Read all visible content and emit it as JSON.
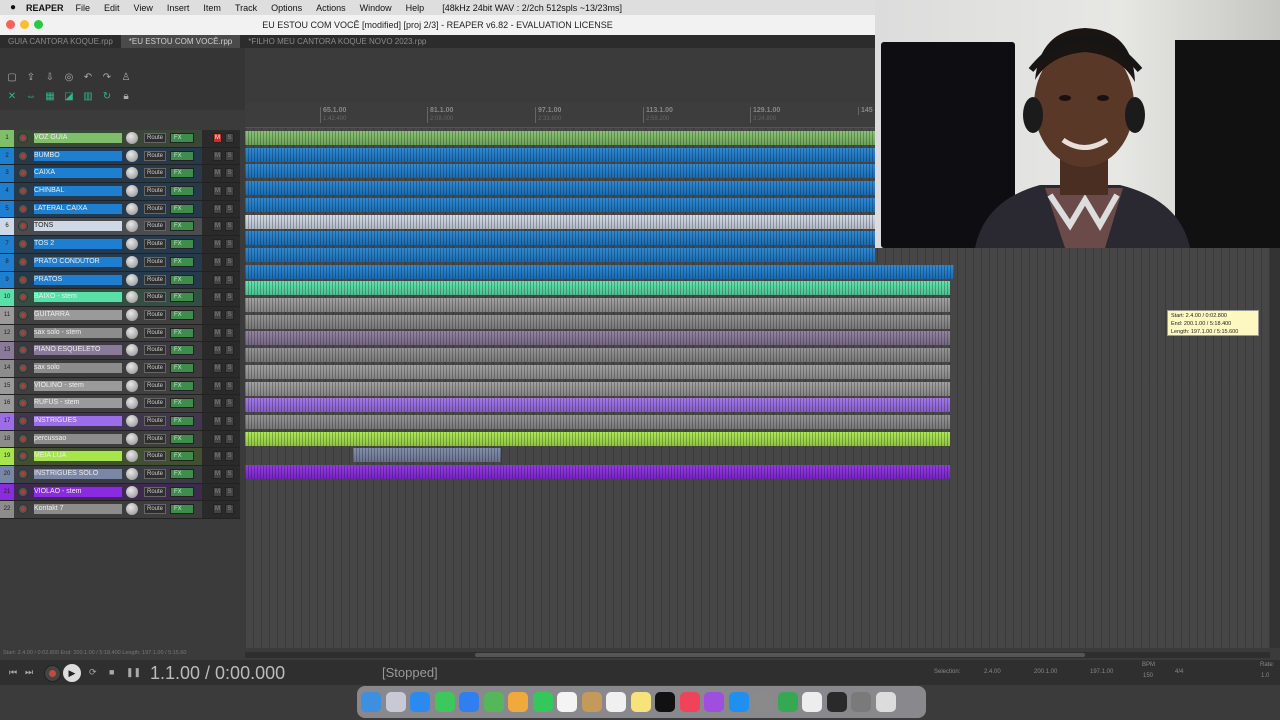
{
  "menubar": {
    "app": "REAPER",
    "items": [
      "File",
      "Edit",
      "View",
      "Insert",
      "Item",
      "Track",
      "Options",
      "Actions",
      "Window",
      "Help"
    ],
    "info": "[48kHz 24bit WAV : 2/2ch 512spls ~13/23ms]"
  },
  "window": {
    "title": "EU ESTOU COM VOCÊ [modified] [proj 2/3] - REAPER v6.82 - EVALUATION LICENSE"
  },
  "project_tabs": [
    {
      "label": "GUIA CANTORA KOQUE.rpp",
      "active": false
    },
    {
      "label": "*EU ESTOU COM VOCÊ.rpp",
      "active": true
    },
    {
      "label": "*FILHO MEU CANTORA KOQUE NOVO 2023.rpp",
      "active": false
    }
  ],
  "ruler": {
    "marks": [
      {
        "bar": "65.1.00",
        "time": "1:42.400"
      },
      {
        "bar": "81.1.00",
        "time": "2:08.000"
      },
      {
        "bar": "97.1.00",
        "time": "2:33.600"
      },
      {
        "bar": "113.1.00",
        "time": "2:59.200"
      },
      {
        "bar": "129.1.00",
        "time": "3:24.800"
      },
      {
        "bar": "145",
        "time": ""
      }
    ]
  },
  "track_labels": {
    "route": "Route",
    "fx": "FX",
    "mute": "M",
    "solo": "S"
  },
  "tracks": [
    {
      "num": "1",
      "name": "VOZ GUIA",
      "color": "#7fbf6a",
      "muted": true
    },
    {
      "num": "2",
      "name": "BUMBO",
      "color": "#1e7fd0",
      "muted": false
    },
    {
      "num": "3",
      "name": "CAIXA",
      "color": "#1e7fd0",
      "muted": false
    },
    {
      "num": "4",
      "name": "CHINBAL",
      "color": "#1e7fd0",
      "muted": false
    },
    {
      "num": "5",
      "name": "LATERAL CAIXA",
      "color": "#1e7fd0",
      "muted": false
    },
    {
      "num": "6",
      "name": "TONS",
      "color": "#cfd8e6",
      "muted": false
    },
    {
      "num": "7",
      "name": "TOS 2",
      "color": "#1e7fd0",
      "muted": false
    },
    {
      "num": "8",
      "name": "PRATO CONDUTOR",
      "color": "#1e7fd0",
      "muted": false
    },
    {
      "num": "9",
      "name": "PRATOS",
      "color": "#1e7fd0",
      "muted": false
    },
    {
      "num": "10",
      "name": "BAIXO - stem",
      "color": "#58e0a8",
      "muted": false
    },
    {
      "num": "11",
      "name": "GUITARRA",
      "color": "#9a9a9a",
      "muted": false
    },
    {
      "num": "12",
      "name": "sax solo - stem",
      "color": "#8c8c8c",
      "muted": false
    },
    {
      "num": "13",
      "name": "PIANO ESQUELETO",
      "color": "#8a7a9a",
      "muted": false
    },
    {
      "num": "14",
      "name": "sax solo",
      "color": "#8c8c8c",
      "muted": false
    },
    {
      "num": "15",
      "name": "VIOLINO - stem",
      "color": "#9a9a9a",
      "muted": false
    },
    {
      "num": "16",
      "name": "RUFUS - stem",
      "color": "#9a9a9a",
      "muted": false
    },
    {
      "num": "17",
      "name": "INSTRIGUES",
      "color": "#9b6ee8",
      "muted": false
    },
    {
      "num": "18",
      "name": "percussao",
      "color": "#8c8c8c",
      "muted": false
    },
    {
      "num": "19",
      "name": "MEIA LUA",
      "color": "#a6e64a",
      "muted": false
    },
    {
      "num": "20",
      "name": "INSTRIGUES SOLO",
      "color": "#7a86a6",
      "muted": false
    },
    {
      "num": "21",
      "name": "VIOLAO - stem",
      "color": "#8a2be2",
      "muted": false
    },
    {
      "num": "22",
      "name": "Kontakt 7",
      "color": "#8c8c8c",
      "muted": false
    }
  ],
  "tooltip": {
    "line1": "Start: 2.4.00 / 0:02.800",
    "line2": "End: 200.1.00 / 5:18.400",
    "line3": "Length: 197.1.00 / 5:15.600"
  },
  "status_line": "Start: 2.4.00 / 0:02.800 End: 200.1.00 / 5:18.400 Length: 197.1.00 / 5:15.60",
  "transport": {
    "timecode": "1.1.00 / 0:00.000",
    "state": "[Stopped]",
    "selection_label": "Selection:",
    "sel_start": "2.4.00",
    "sel_end": "200.1.00",
    "sel_length": "197.1.00",
    "bpm_label": "BPM",
    "bpm": "150",
    "timesig": "4/4",
    "rate_label": "Rate:",
    "rate": "1.0"
  },
  "colors": {
    "accent": "#2fb884",
    "record": "#c64a3a",
    "mute_on": "#c8302c"
  }
}
